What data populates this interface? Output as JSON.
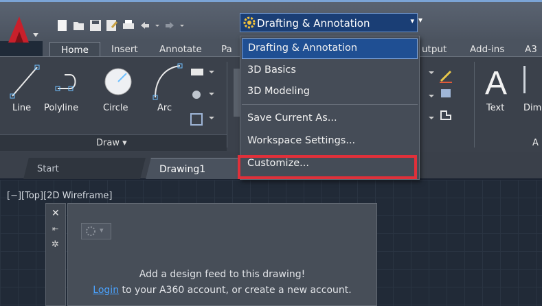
{
  "qat": {
    "icons": [
      "new-icon",
      "open-icon",
      "save-icon",
      "save-as-icon",
      "plot-icon",
      "undo-icon",
      "redo-icon"
    ]
  },
  "workspace": {
    "current": "Drafting & Annotation",
    "arrow": "▾",
    "extra": "▾"
  },
  "ribbon_tabs": [
    "Home",
    "Insert",
    "Annotate",
    "Pa",
    "utput",
    "Add-ins",
    "A3"
  ],
  "draw_tools": [
    "Line",
    "Polyline",
    "Circle",
    "Arc"
  ],
  "draw_panel_title": "Draw ▾",
  "right_tools": [
    "Text",
    "Dim"
  ],
  "right_panel_title": "A",
  "doc_tabs": [
    "Start",
    "Drawing1"
  ],
  "viewport_label": "[−][Top][2D Wireframe]",
  "design_feed": {
    "message": "Add a design feed to this drawing!",
    "login_link": "Login",
    "message_rest": " to your A360 account, or create a new account."
  },
  "menu": {
    "items": [
      "Drafting & Annotation",
      "3D Basics",
      "3D Modeling",
      "Save Current As...",
      "Workspace Settings...",
      "Customize..."
    ]
  },
  "colors": {
    "accent": "#1f4f93",
    "highlight": "#e0303a",
    "link": "#4aa3ff"
  }
}
